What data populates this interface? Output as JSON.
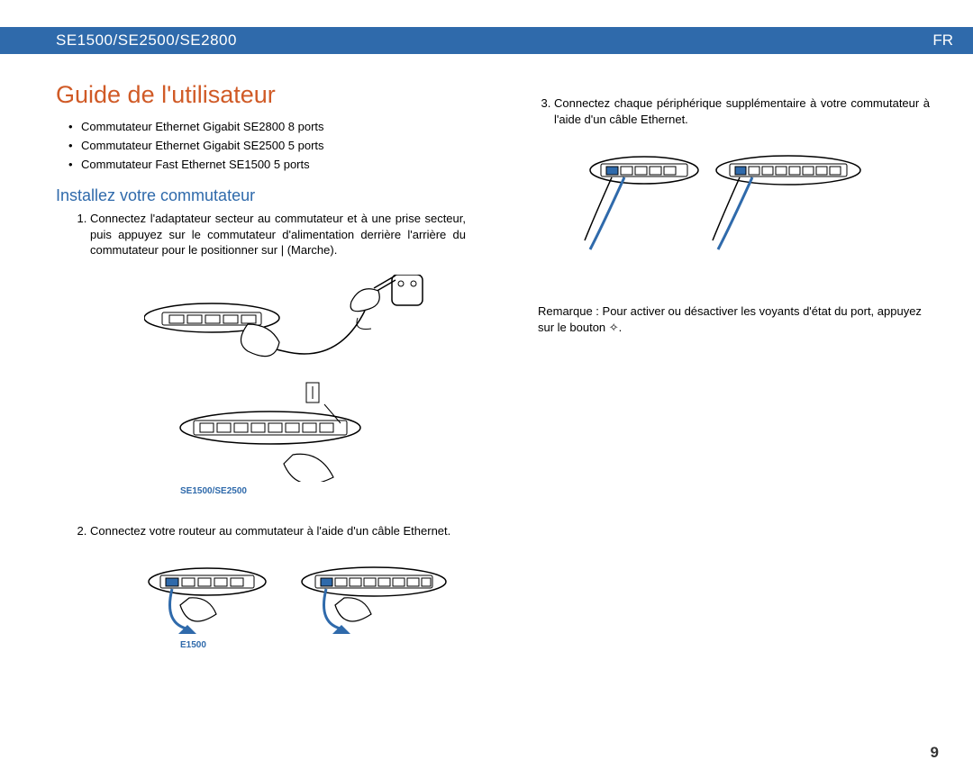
{
  "header": {
    "model": "SE1500/SE2500/SE2800",
    "lang": "FR"
  },
  "title": "Guide de l'utilisateur",
  "products": [
    "Commutateur Ethernet Gigabit SE2800 8 ports",
    "Commutateur Ethernet Gigabit SE2500 5 ports",
    "Commutateur Fast Ethernet SE1500 5 ports"
  ],
  "section_heading": "Installez votre commutateur",
  "steps": {
    "s1": "Connectez l'adaptateur secteur au commutateur et à une prise secteur, puis appuyez sur le commutateur d'alimentation derrière l'arrière du commutateur pour le positionner sur | (Marche).",
    "s2": "Connectez votre routeur au commutateur à l'aide d'un câble Ethernet.",
    "s3": "Connectez chaque périphérique supplémentaire à votre commutateur à l'aide d'un câble Ethernet."
  },
  "figcaps": {
    "fig1": "SE1500/SE2500",
    "fig2": "E1500"
  },
  "note": "Remarque : Pour activer ou désactiver les voyants d'état du port, appuyez sur le bouton ✧.",
  "pageno": "9"
}
